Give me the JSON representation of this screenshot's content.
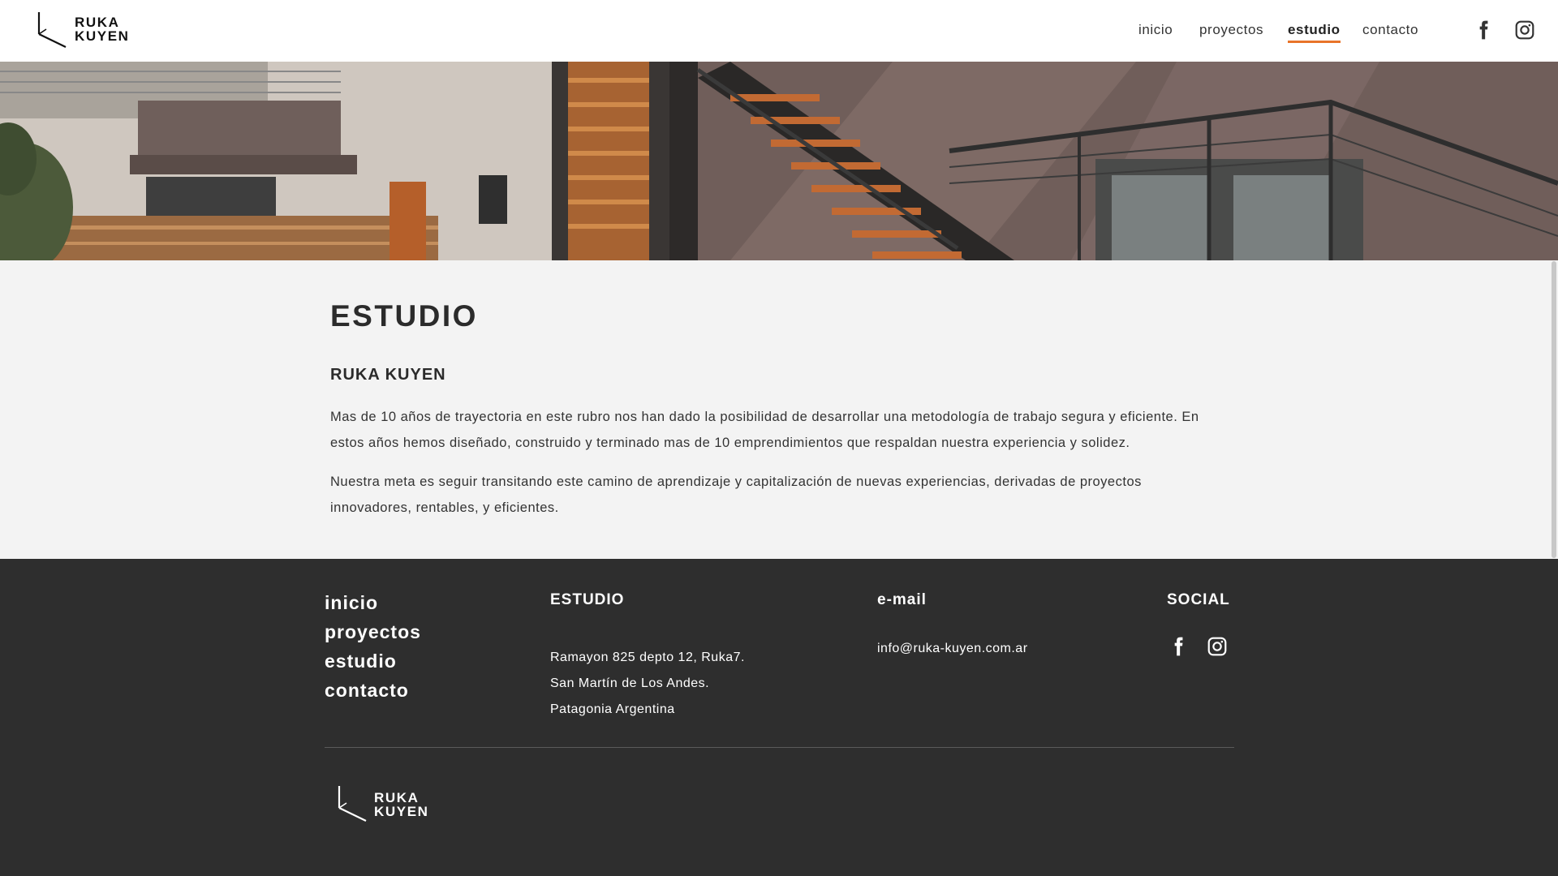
{
  "brand": {
    "line1": "RUKA",
    "line2": "KUYEN"
  },
  "nav": {
    "items": [
      {
        "label": "inicio",
        "active": false
      },
      {
        "label": "proyectos",
        "active": false
      },
      {
        "label": "estudio",
        "active": true
      },
      {
        "label": "contacto",
        "active": false
      }
    ],
    "social_icons": [
      "facebook-icon",
      "instagram-icon"
    ]
  },
  "main": {
    "title": "ESTUDIO",
    "subtitle": "RUKA KUYEN",
    "paragraphs": [
      "Mas de 10 años de trayectoria en este rubro nos han dado la posibilidad de desarrollar una metodología de trabajo segura y eficiente. En estos años hemos diseñado, construido y terminado mas de 10 emprendimientos que respaldan nuestra experiencia y solidez.",
      "Nuestra meta es seguir transitando este camino de aprendizaje y capitalización de nuevas experiencias, derivadas de proyectos innovadores, rentables, y eficientes."
    ]
  },
  "footer": {
    "nav": [
      "inicio",
      "proyectos",
      "estudio",
      "contacto"
    ],
    "studio": {
      "heading": "ESTUDIO",
      "address": [
        "Ramayon 825 depto 12, Ruka7.",
        "San Martín de Los Andes.",
        "Patagonia Argentina"
      ]
    },
    "email": {
      "heading": "e-mail",
      "address": "info@ruka-kuyen.com.ar"
    },
    "social": {
      "heading": "SOCIAL",
      "icons": [
        "facebook-icon",
        "instagram-icon"
      ]
    }
  },
  "colors": {
    "accent": "#e8742a",
    "footer_bg": "#2e2e2e",
    "page_bg": "#f3f3f3",
    "text_dark": "#2b2b2b"
  }
}
